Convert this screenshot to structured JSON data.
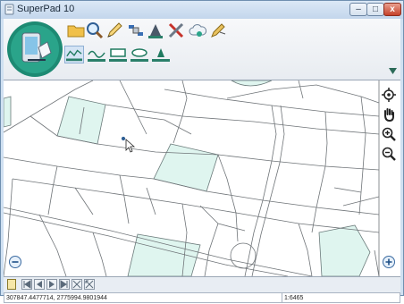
{
  "window": {
    "title": "SuperPad 10"
  },
  "titlebar_buttons": {
    "minimize": "–",
    "maximize": "□",
    "close": "x"
  },
  "toolbar": {
    "icons": [
      "folder-icon",
      "search-icon",
      "edit-pen-icon",
      "satellite-icon",
      "survey-icon",
      "tools-icon",
      "cloud-sync-icon",
      "pen-edit-icon"
    ],
    "draw_tools": [
      "polyline-draw-icon",
      "curve-draw-icon",
      "rectangle-draw-icon",
      "ellipse-draw-icon",
      "point-draw-icon"
    ],
    "selected_draw_tool": "polyline-draw-icon"
  },
  "map_nav": [
    "locate-icon",
    "pan-hand-icon",
    "zoom-in-icon",
    "zoom-out-icon"
  ],
  "status": {
    "coordinates": "307847.4477714, 2775994.9801944",
    "scale": "1:6465"
  },
  "map_controls": {
    "zoom_minus": "−",
    "zoom_plus": "+"
  },
  "colors": {
    "park": "#dff5ef",
    "window_frame": "#cfe0f1"
  }
}
